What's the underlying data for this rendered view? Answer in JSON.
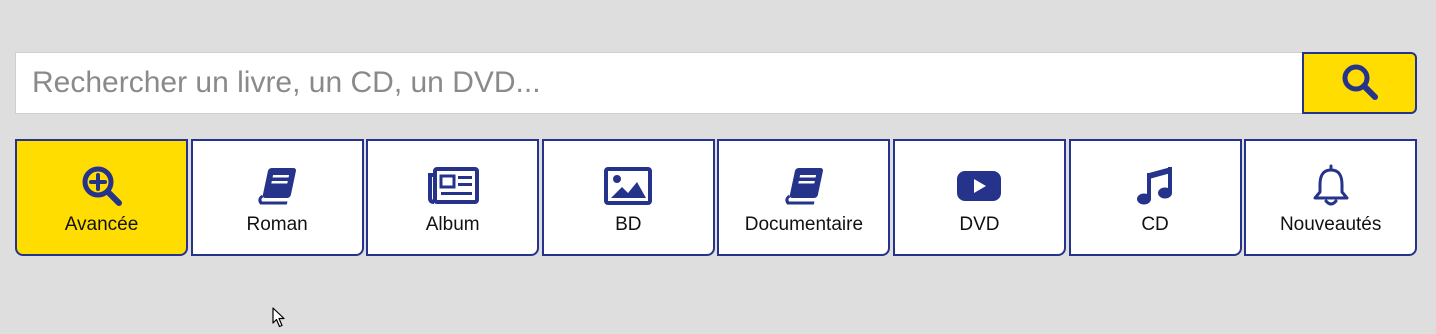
{
  "search": {
    "placeholder": "Rechercher un livre, un CD, un DVD...",
    "value": "",
    "button_icon": "search-icon"
  },
  "categories": [
    {
      "label": "Avancée",
      "icon": "search-plus-icon",
      "active": true
    },
    {
      "label": "Roman",
      "icon": "book-icon",
      "active": false
    },
    {
      "label": "Album",
      "icon": "newspaper-icon",
      "active": false
    },
    {
      "label": "BD",
      "icon": "image-icon",
      "active": false
    },
    {
      "label": "Documentaire",
      "icon": "book-icon",
      "active": false
    },
    {
      "label": "DVD",
      "icon": "video-play-icon",
      "active": false
    },
    {
      "label": "CD",
      "icon": "music-note-icon",
      "active": false
    },
    {
      "label": "Nouveautés",
      "icon": "bell-icon",
      "active": false
    }
  ],
  "colors": {
    "accent": "#ffdd00",
    "brand": "#26338a",
    "background": "#dedede"
  }
}
